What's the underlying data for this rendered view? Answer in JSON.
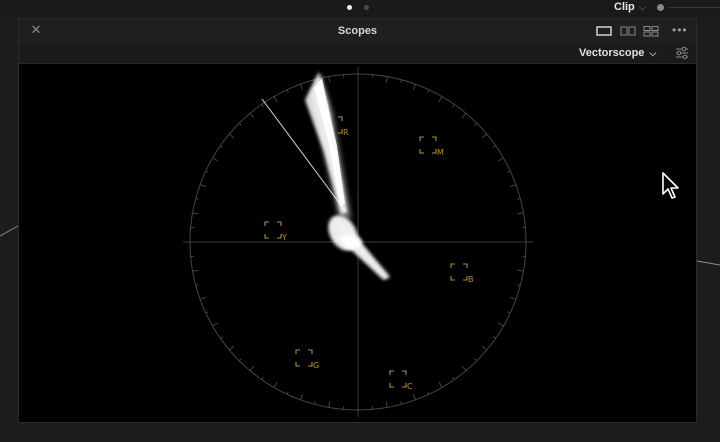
{
  "top_bar": {
    "pagination": {
      "active_index": 0,
      "count": 2
    },
    "clip_label": "Clip",
    "chevron_glyph": "⌵"
  },
  "scopes_panel": {
    "title": "Scopes",
    "close_glyph": "✕",
    "more_glyph": "•••",
    "layout_options": [
      "single-view-icon",
      "dual-view-icon",
      "quad-view-icon"
    ],
    "active_layout": "single-view-icon",
    "scope_type": "Vectorscope",
    "scope_type_chevron": "⌵",
    "settings_icon": "sliders-icon"
  },
  "vectorscope": {
    "targets": [
      {
        "label": "R"
      },
      {
        "label": "M"
      },
      {
        "label": "B"
      },
      {
        "label": "C"
      },
      {
        "label": "G"
      },
      {
        "label": "Y"
      }
    ],
    "colors": {
      "graticule": "#454545",
      "target": "#b6902a",
      "trace": "#ffffff",
      "skin_tone_line": "#d8d8d8"
    }
  },
  "colors": {
    "app_background": "#1c1c1e",
    "panel_header": "#1f1f22",
    "scope_background": "#000000",
    "active_dot": "#f2f2f2",
    "inactive_dot": "#4a4a4a"
  }
}
